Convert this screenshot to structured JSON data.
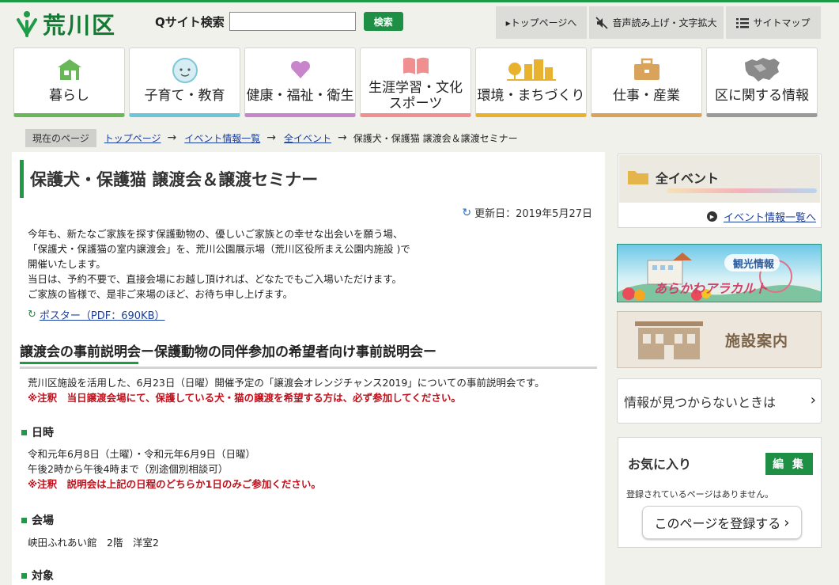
{
  "header": {
    "logo_text": "荒川区",
    "search_label": "Qサイト検索",
    "search_value": "",
    "search_button": "検索",
    "util": [
      {
        "label": "▸トップページへ",
        "icon": "play-icon"
      },
      {
        "label": "音声読み上げ・文字拡大",
        "icon": "voice-icon"
      },
      {
        "label": "サイトマップ",
        "icon": "list-icon"
      }
    ]
  },
  "nav": [
    {
      "label": "暮らし",
      "color": "#6ab75a"
    },
    {
      "label": "子育て・教育",
      "color": "#6dc6d8"
    },
    {
      "label": "健康・福祉・衛生",
      "color": "#c885cc"
    },
    {
      "label": "生涯学習・文化スポーツ",
      "line1": "生涯学習・文化",
      "line2": "スポーツ",
      "color": "#ef8f8f"
    },
    {
      "label": "環境・まちづくり",
      "color": "#e8b12e"
    },
    {
      "label": "仕事・産業",
      "color": "#d9a35c"
    },
    {
      "label": "区に関する情報",
      "color": "#9a9a9a"
    }
  ],
  "breadcrumb": {
    "here_label": "現在のページ",
    "links": [
      "トップページ",
      "イベント情報一覧",
      "全イベント"
    ],
    "current": "保護犬・保護猫 譲渡会＆譲渡セミナー"
  },
  "article": {
    "title": "保護犬・保護猫 譲渡会＆譲渡セミナー",
    "updated": "更新日：2019年5月27日",
    "intro": [
      "今年も、新たなご家族を探す保護動物の、優しいご家族との幸せな出会いを願う場、",
      "「保護犬・保護猫の室内譲渡会」を、荒川公園展示場（荒川区役所まえ公園内施設 )で",
      "開催いたします。",
      "当日は、予約不要で、直接会場にお越し頂ければ、どなたでもご入場いただけます。",
      "ご家族の皆様で、是非ご来場のほど、お待ち申し上げます。"
    ],
    "poster_link": "ポスター（PDF：690KB）",
    "section_title": "譲渡会の事前説明会ー保護動物の同伴参加の希望者向け事前説明会ー",
    "section_text": "荒川区施設を活用した、6月23日（日曜）開催予定の「譲渡会オレンジチャンス2019」についての事前説明会です。",
    "section_warn": "※注釈　当日譲渡会場にて、保護している犬・猫の譲渡を希望する方は、必ず参加してください。",
    "date_heading": "日時",
    "date_line1": "令和元年6月8日（土曜）・令和元年6月9日（日曜）",
    "date_line2": "午後2時から午後4時まで（別途個別相談可）",
    "date_warn": "※注釈　説明会は上記の日程のどちらか1日のみご参加ください。",
    "venue_heading": "会場",
    "venue_text": "峡田ふれあい館　2階　洋室2",
    "target_heading": "対象"
  },
  "sidebar": {
    "events_title": "全イベント",
    "events_link": "イベント情報一覧へ",
    "banner_text1": "観光情報",
    "banner_text2": "あらかわアラカルト",
    "facilities": "施設案内",
    "not_found": "情報が見つからないときは",
    "favorites_title": "お気に入り",
    "favorites_edit": "編 集",
    "favorites_empty": "登録されているページはありません。",
    "favorites_register": "このページを登録する"
  }
}
